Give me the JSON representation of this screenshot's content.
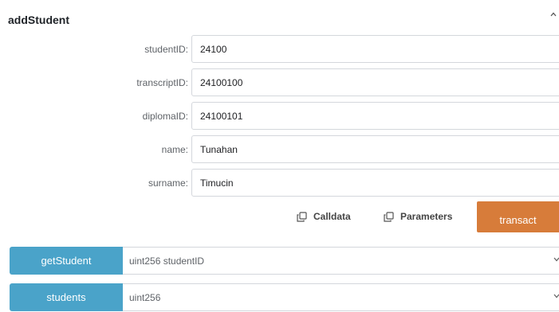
{
  "function": {
    "name": "addStudent"
  },
  "params": [
    {
      "label": "studentID:",
      "value": "24100"
    },
    {
      "label": "transcriptID:",
      "value": "24100100"
    },
    {
      "label": "diplomaID:",
      "value": "24100101"
    },
    {
      "label": "name:",
      "value": "Tunahan"
    },
    {
      "label": "surname:",
      "value": "Timucin"
    }
  ],
  "actions": {
    "calldata_label": "Calldata",
    "parameters_label": "Parameters",
    "transact_label": "transact"
  },
  "calls": [
    {
      "button": "getStudent",
      "placeholder": "uint256 studentID"
    },
    {
      "button": "students",
      "placeholder": "uint256"
    }
  ],
  "icons": {
    "collapse": "chevron-up-icon",
    "copy": "copy-icon",
    "expand": "chevron-down-icon"
  },
  "colors": {
    "transact": "#d77c3a",
    "call": "#4aa3c9"
  }
}
